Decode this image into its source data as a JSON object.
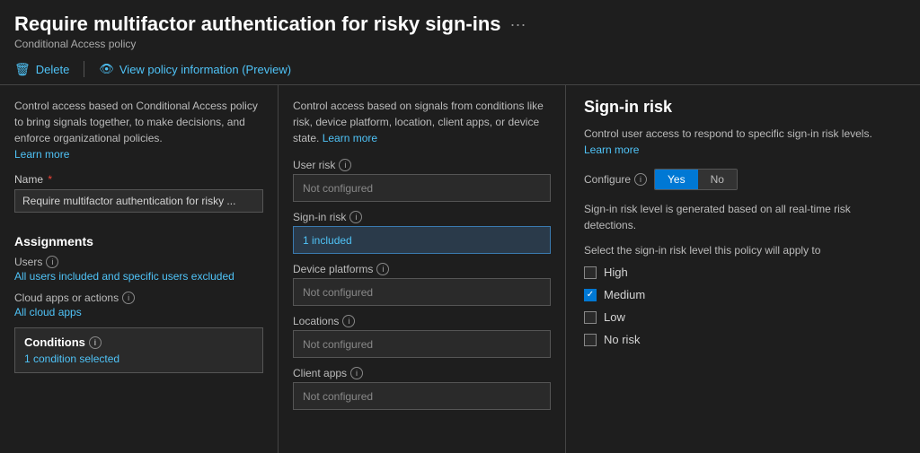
{
  "header": {
    "title": "Require multifactor authentication for risky sign-ins",
    "subtitle": "Conditional Access policy",
    "delete_label": "Delete",
    "view_policy_label": "View policy information (Preview)"
  },
  "left_panel": {
    "description": "Control access based on Conditional Access policy to bring signals together, to make decisions, and enforce organizational policies.",
    "learn_more": "Learn more",
    "name_label": "Name",
    "name_required": "*",
    "name_value": "Require multifactor authentication for risky ...",
    "assignments_title": "Assignments",
    "users_label": "Users",
    "users_value": "All users included and specific users excluded",
    "cloud_apps_label": "Cloud apps or actions",
    "cloud_apps_value": "All cloud apps",
    "conditions_title": "Conditions",
    "conditions_value": "1 condition selected"
  },
  "middle_panel": {
    "description": "Control access based on signals from conditions like risk, device platform, location, client apps, or device state.",
    "learn_more": "Learn more",
    "user_risk_label": "User risk",
    "user_risk_value": "Not configured",
    "sign_in_risk_label": "Sign-in risk",
    "sign_in_risk_value": "1 included",
    "device_platforms_label": "Device platforms",
    "device_platforms_value": "Not configured",
    "locations_label": "Locations",
    "locations_value": "Not configured",
    "client_apps_label": "Client apps",
    "client_apps_value": "Not configured"
  },
  "right_panel": {
    "title": "Sign-in risk",
    "access_description": "Control user access to respond to specific sign-in risk levels.",
    "learn_more": "Learn more",
    "configure_label": "Configure",
    "yes_label": "Yes",
    "no_label": "No",
    "configure_active": "yes",
    "risk_info": "Sign-in risk level is generated based on all real-time risk detections.",
    "select_title": "Select the sign-in risk level this policy will apply to",
    "checkboxes": [
      {
        "label": "High",
        "checked": false
      },
      {
        "label": "Medium",
        "checked": true
      },
      {
        "label": "Low",
        "checked": false
      },
      {
        "label": "No risk",
        "checked": false
      }
    ]
  },
  "icons": {
    "trash": "🗑",
    "info": "ⓘ",
    "eye": "👁",
    "ellipsis": "···"
  }
}
